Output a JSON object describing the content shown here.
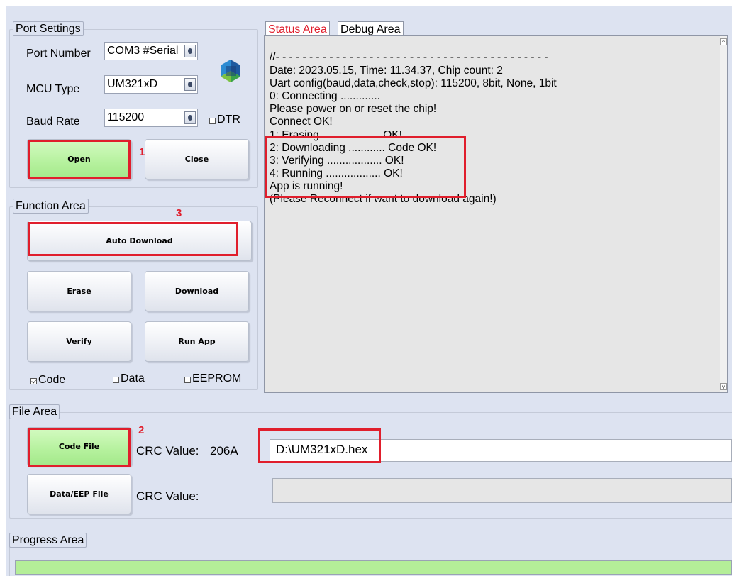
{
  "port_settings": {
    "legend": "Port Settings",
    "port_number_label": "Port Number",
    "port_number_value": "COM3 #Serial",
    "mcu_type_label": "MCU Type",
    "mcu_type_value": "UM321xD",
    "baud_rate_label": "Baud Rate",
    "baud_rate_value": "115200",
    "dtr_label": "DTR",
    "open_label": "Open",
    "close_label": "Close"
  },
  "function_area": {
    "legend": "Function Area",
    "auto_download_label": "Auto Download",
    "erase_label": "Erase",
    "download_label": "Download",
    "verify_label": "Verify",
    "run_app_label": "Run App",
    "code_label": "Code",
    "data_label": "Data",
    "eeprom_label": "EEPROM"
  },
  "tabs": {
    "status": "Status Area",
    "debug": "Debug Area"
  },
  "log": [
    "//- - - - - - - - - - - - - - - - - - - - - - - - - - - - - - - - - - - - - - - - -",
    "Date: 2023.05.15, Time: 11.34.37, Chip count: 2",
    "Uart config(baud,data,check,stop): 115200, 8bit, None, 1bit",
    "0: Connecting .............",
    "    Please power on or reset the chip!",
    "    Connect OK!",
    "1: Erasing ................... OK!",
    "2: Downloading ............ Code OK!",
    "3: Verifying .................. OK!",
    "4: Running .................. OK!",
    "    App is running!",
    "(Please Reconnect if want to download again!)"
  ],
  "file_area": {
    "legend": "File Area",
    "code_file_label": "Code File",
    "crc1_label": "CRC Value:",
    "crc1_value": "206A",
    "code_path": "D:\\UM321xD.hex",
    "data_eep_label": "Data/EEP File",
    "crc2_label": "CRC Value:"
  },
  "progress_area": {
    "legend": "Progress Area",
    "progress": 1.0
  },
  "annotations": [
    "1",
    "2",
    "3"
  ],
  "colors": {
    "annotation_red": "#e01e2c",
    "green_button": "#b5f19d",
    "progress_green": "#b4ee98",
    "tab_active_text": "#e01e2c"
  },
  "icons": [
    "mcu-chip-logo-icon",
    "scroll-up-icon",
    "scroll-down-icon"
  ]
}
